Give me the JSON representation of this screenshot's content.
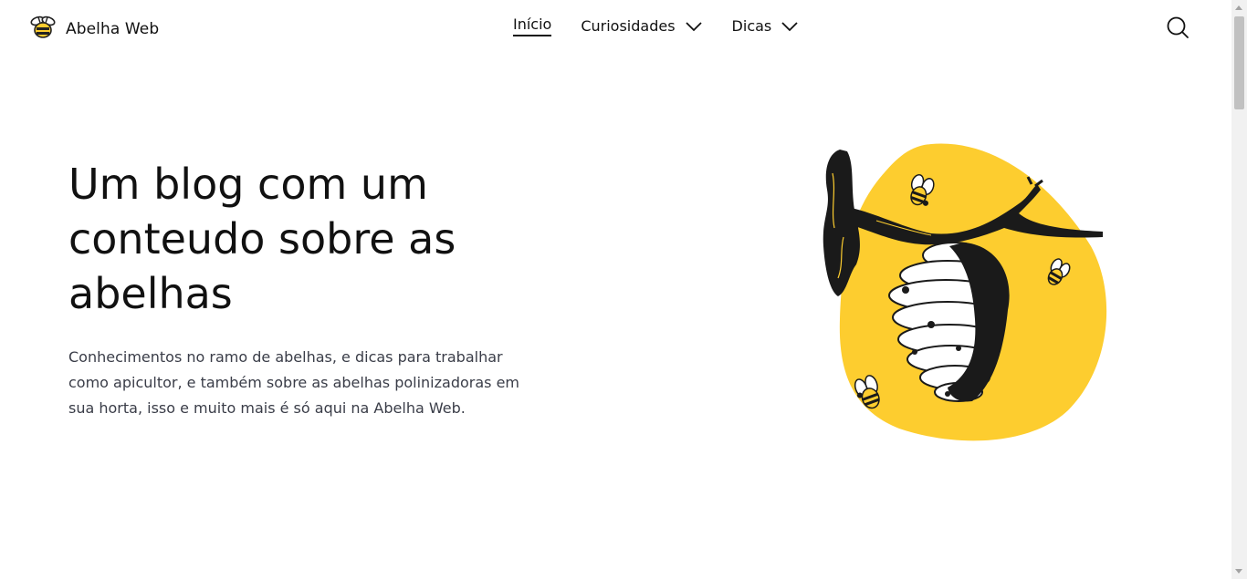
{
  "header": {
    "brand": {
      "name": "Abelha Web",
      "icon": "bee-logo-icon"
    },
    "nav": [
      {
        "label": "Início",
        "active": true,
        "has_dropdown": false
      },
      {
        "label": "Curiosidades",
        "active": false,
        "has_dropdown": true
      },
      {
        "label": "Dicas",
        "active": false,
        "has_dropdown": true
      }
    ],
    "search_icon": "search-icon"
  },
  "hero": {
    "title": "Um blog com um conteudo sobre as abelhas",
    "description": "Conhecimentos no ramo de abelhas, e dicas para trabalhar como apicultor, e também sobre as abelhas polinizadoras em sua horta, isso e muito mais é só aqui na Abelha Web.",
    "illustration": "beehive-illustration"
  },
  "colors": {
    "accent": "#FDCD2F",
    "dark": "#1a1a1a",
    "text": "#111111",
    "muted_text": "#3a3d48"
  }
}
